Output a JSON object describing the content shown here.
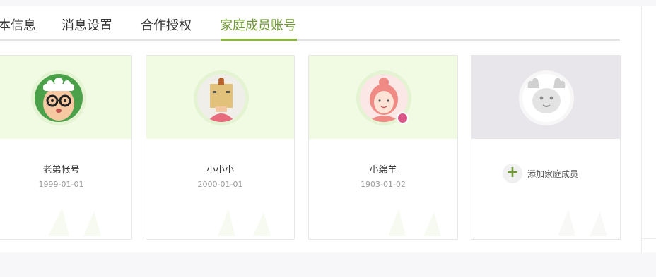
{
  "tabs": [
    {
      "label": "本信息"
    },
    {
      "label": "消息设置"
    },
    {
      "label": "合作授权"
    },
    {
      "label": "家庭成员账号"
    }
  ],
  "members": [
    {
      "name": "老弟帐号",
      "birthday": "1999-01-01"
    },
    {
      "name": "小小小",
      "birthday": "2000-01-01"
    },
    {
      "name": "小绵羊",
      "birthday": "1903-01-02"
    }
  ],
  "add_member": {
    "label": "添加家庭成员"
  },
  "colors": {
    "accent": "#8bb542",
    "card_top": "#f1fbe4",
    "add_top": "#e8e6ea"
  }
}
